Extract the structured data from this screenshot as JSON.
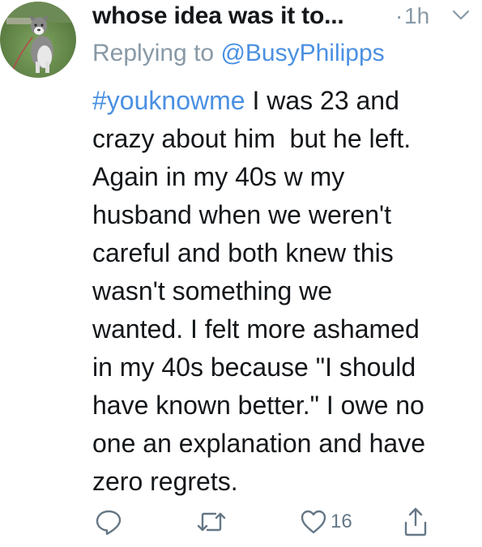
{
  "tweet": {
    "display_name": "whose idea was it to...",
    "separator": "·",
    "time": "1h",
    "reply_prefix": "Replying to ",
    "reply_handle": "@BusyPhilipps",
    "hashtag": "#youknowme",
    "lines": [
      " I was 23 and",
      "crazy about him  but he left.",
      "Again in my 40s w my",
      "husband when we weren't",
      "careful and both knew this",
      "wasn't something we",
      "wanted. I felt more ashamed",
      "in my 40s because \"I should",
      "have known better.\" I owe no",
      "one an explanation and have",
      "zero regrets."
    ],
    "actions": {
      "reply_icon": "reply-icon",
      "retweet_icon": "retweet-icon",
      "like_icon": "heart-icon",
      "like_count": "16",
      "share_icon": "share-icon"
    }
  },
  "colors": {
    "link": "#4a90e2",
    "muted": "#8899a6",
    "text": "#14171a",
    "icon": "#657786"
  }
}
